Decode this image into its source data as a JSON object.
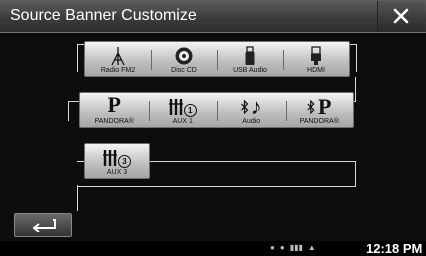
{
  "header": {
    "title": "Source Banner Customize"
  },
  "rows": [
    {
      "tiles": [
        {
          "label": "Radio FM2",
          "icon": "antenna-icon"
        },
        {
          "label": "Disc CD",
          "icon": "disc-icon"
        },
        {
          "label": "USB Audio",
          "icon": "usb-icon"
        },
        {
          "label": "HDMI",
          "icon": "hdmi-icon"
        }
      ]
    },
    {
      "tiles": [
        {
          "label": "PANDORA®",
          "icon": "pandora-icon",
          "glyph": "P"
        },
        {
          "label": "AUX 1",
          "icon": "aux-icon",
          "num": "1"
        },
        {
          "label": "Audio",
          "icon": "bluetooth-audio-icon",
          "glyph": "♪"
        },
        {
          "label": "PANDORA®",
          "icon": "bluetooth-pandora-icon",
          "glyph": "P"
        }
      ]
    },
    {
      "tiles": [
        {
          "label": "AUX 3",
          "icon": "aux-icon",
          "num": "3"
        }
      ]
    }
  ],
  "status": {
    "time": "12:18 PM"
  }
}
